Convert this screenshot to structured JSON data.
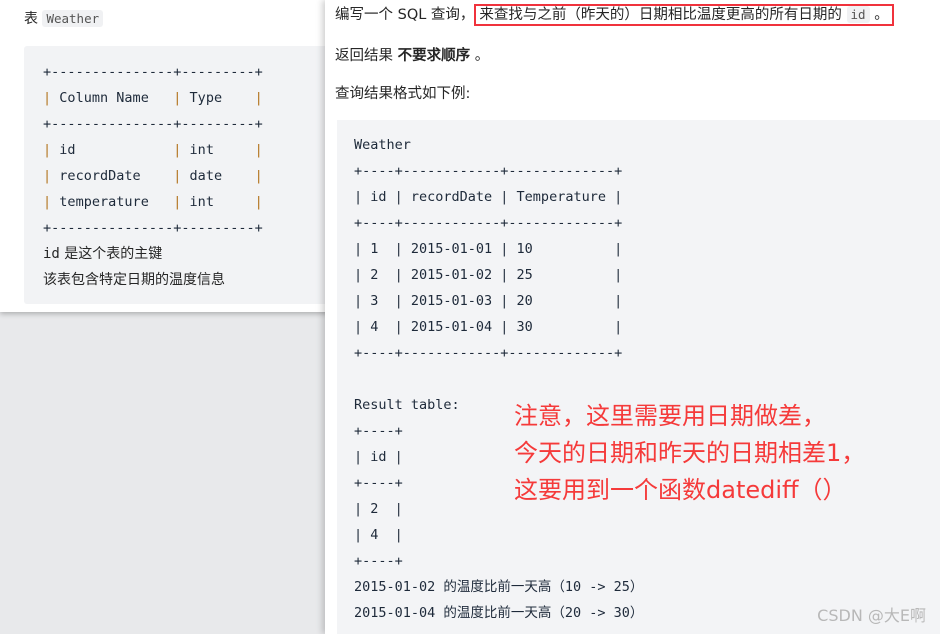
{
  "left_panel": {
    "title_prefix": "表",
    "table_name": "Weather",
    "schema_lines": [
      "+---------------+---------+",
      "| Column Name   | Type    |",
      "+---------------+---------+",
      "| id            | int     |",
      "| recordDate    | date    |",
      "| temperature   | int     |",
      "+---------------+---------+"
    ],
    "note_1_code": "id",
    "note_1_text": " 是这个表的主键",
    "note_2": "该表包含特定日期的温度信息"
  },
  "right_panel": {
    "question_prefix": "编写一个 SQL 查询，",
    "question_highlight": "来查找与之前（昨天的）日期相比温度更高的所有日期的",
    "question_code": "id",
    "question_end": "。",
    "order_prefix": "返回结果 ",
    "order_bold": "不要求顺序",
    "order_end": " 。",
    "format_label": "查询结果格式如下例:",
    "example_lines": [
      "Weather",
      "+----+------------+-------------+",
      "| id | recordDate | Temperature |",
      "+----+------------+-------------+",
      "| 1  | 2015-01-01 | 10          |",
      "| 2  | 2015-01-02 | 25          |",
      "| 3  | 2015-01-03 | 20          |",
      "| 4  | 2015-01-04 | 30          |",
      "+----+------------+-------------+",
      "",
      "Result table:",
      "+----+",
      "| id |",
      "+----+",
      "| 2  |",
      "| 4  |",
      "+----+",
      "2015-01-02 的温度比前一天高（10 -> 25）",
      "2015-01-04 的温度比前一天高（20 -> 30）"
    ],
    "annotation_lines": [
      "注意，这里需要用日期做差，",
      "今天的日期和昨天的日期相差1，",
      "这要用到一个函数datediff（）"
    ],
    "watermark": "CSDN @大E啊"
  },
  "colors": {
    "highlight_border": "#f0323c",
    "annotation": "#f53a3a",
    "pipe_color": "#b3741e"
  }
}
